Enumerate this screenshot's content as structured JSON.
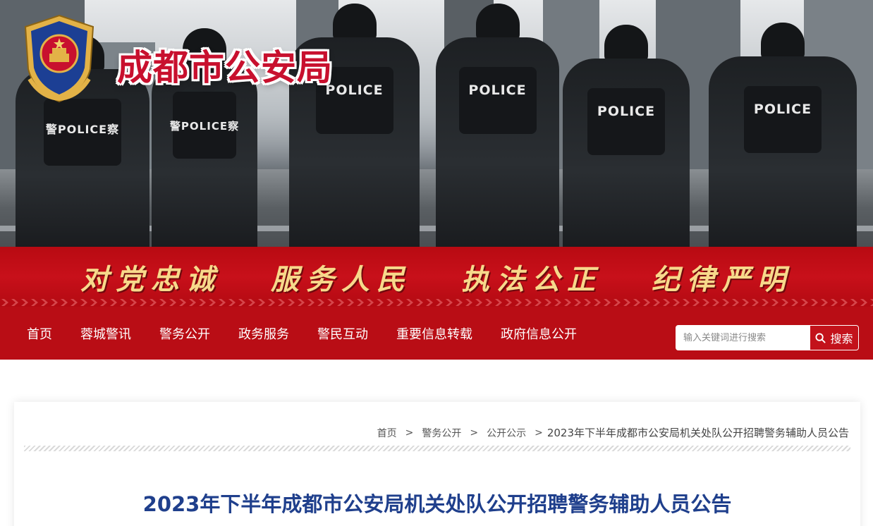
{
  "header": {
    "site_title": "成都市公安局",
    "vest_label": "POLICE",
    "vest_label_cn": "警POLICE察"
  },
  "slogans": [
    "对党忠诚",
    "服务人民",
    "执法公正",
    "纪律严明"
  ],
  "nav": {
    "items": [
      "首页",
      "蓉城警讯",
      "警务公开",
      "政务服务",
      "警民互动",
      "重要信息转载",
      "政府信息公开"
    ],
    "search_placeholder": "输入关键词进行搜索",
    "search_button": "搜索"
  },
  "breadcrumb": {
    "items": [
      "首页",
      "警务公开",
      "公开公示"
    ],
    "separator": ">",
    "current": "2023年下半年成都市公安局机关处队公开招聘警务辅助人员公告"
  },
  "article": {
    "title": "2023年下半年成都市公安局机关处队公开招聘警务辅助人员公告"
  },
  "colors": {
    "brand_red": "#b90d15",
    "slogan_gold": "#f7d98b",
    "title_blue": "#1f3f8c"
  }
}
